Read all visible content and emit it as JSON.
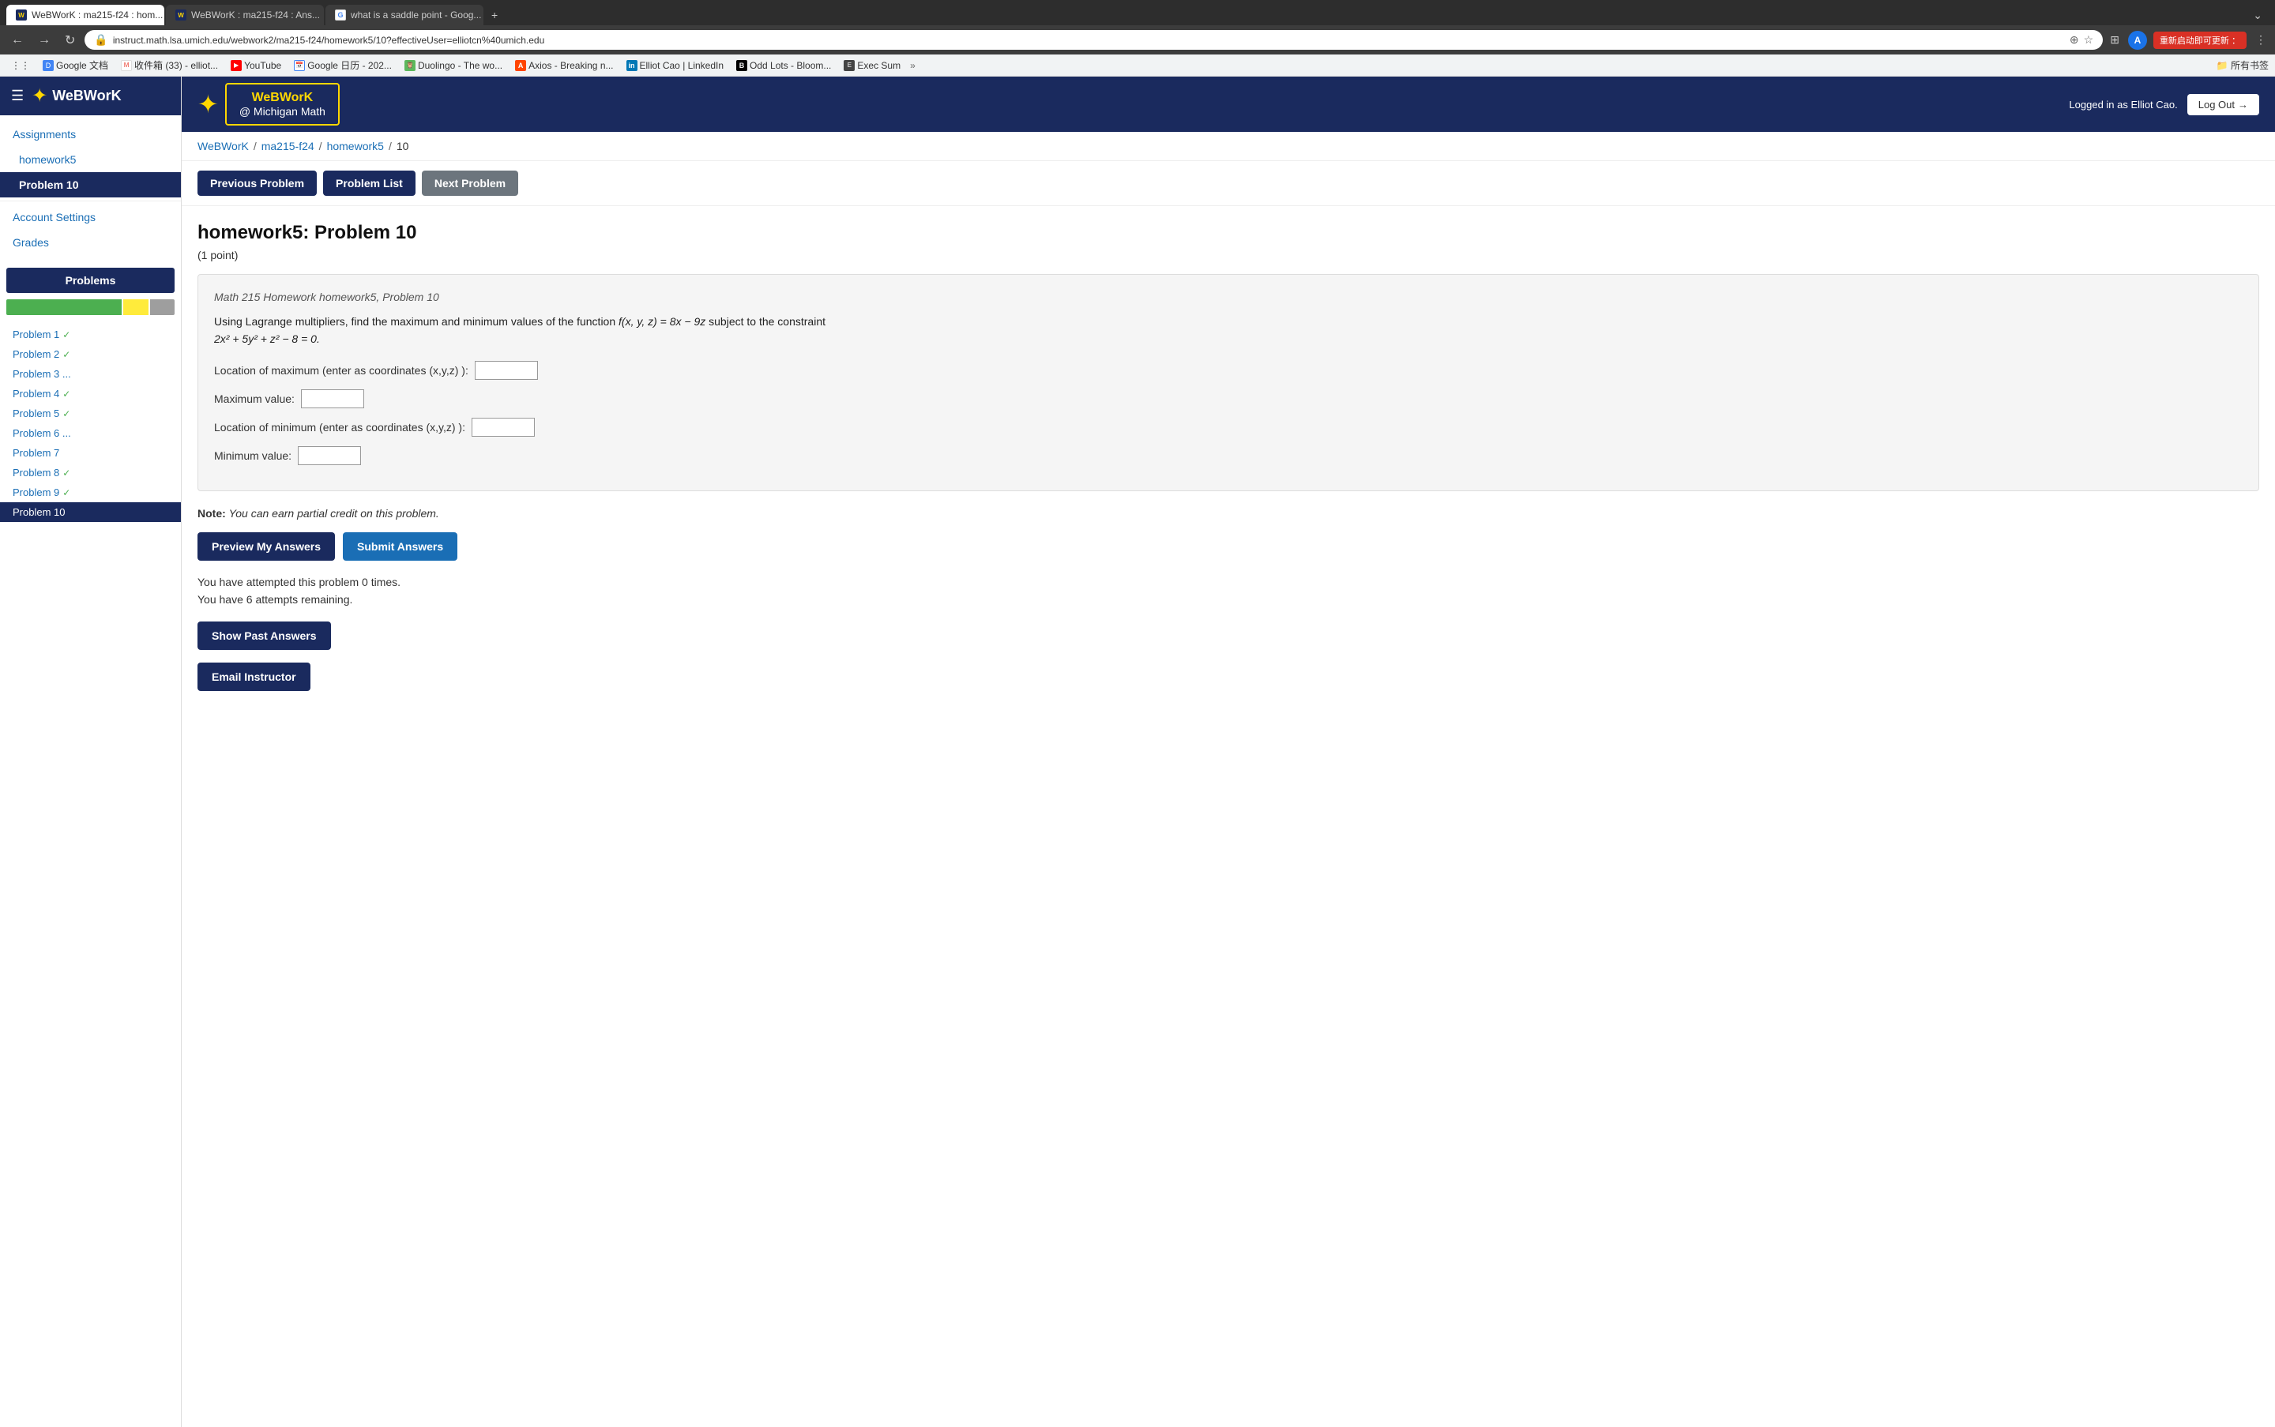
{
  "browser": {
    "tabs": [
      {
        "id": "tab1",
        "label": "WeBWorK : ma215-f24 : hom...",
        "active": true,
        "favicon_type": "webwork"
      },
      {
        "id": "tab2",
        "label": "WeBWorK : ma215-f24 : Ans...",
        "active": false,
        "favicon_type": "webwork"
      },
      {
        "id": "tab3",
        "label": "what is a saddle point - Goog...",
        "active": false,
        "favicon_type": "google"
      }
    ],
    "address": "instruct.math.lsa.umich.edu/webwork2/ma215-f24/homework5/10?effectiveUser=elliotcn%40umich.edu",
    "profile_initial": "A",
    "cjk_label": "重新启动即可更新 ："
  },
  "bookmarks": [
    {
      "label": "Google 文档",
      "favicon_type": "gdoc"
    },
    {
      "label": "收件箱 (33) - elliot...",
      "favicon_type": "gmail"
    },
    {
      "label": "YouTube",
      "favicon_type": "yt"
    },
    {
      "label": "Google 日历 - 202...",
      "favicon_type": "cal"
    },
    {
      "label": "Duolingo - The wo...",
      "favicon_type": "duo"
    },
    {
      "label": "Axios - Breaking n...",
      "favicon_type": "axios"
    },
    {
      "label": "Elliot Cao | LinkedIn",
      "favicon_type": "li"
    },
    {
      "label": "Odd Lots - Bloom...",
      "favicon_type": "bb"
    },
    {
      "label": "Exec Sum",
      "favicon_type": "exec"
    }
  ],
  "sidebar": {
    "logo_line1": "WeBWorK",
    "logo_line2": "@ Michigan Math",
    "nav_items": [
      {
        "label": "Assignments",
        "id": "assignments",
        "active": false,
        "indent": false
      },
      {
        "label": "homework5",
        "id": "homework5",
        "active": false,
        "indent": true
      },
      {
        "label": "Problem 10",
        "id": "problem10",
        "active": true,
        "indent": true
      }
    ],
    "bottom_nav": [
      {
        "label": "Account Settings",
        "id": "account-settings"
      },
      {
        "label": "Grades",
        "id": "grades"
      }
    ],
    "problems_header": "Problems",
    "progress": {
      "green": 7,
      "yellow": 1.5,
      "gray": 1.5
    },
    "problem_list": [
      {
        "label": "Problem 1",
        "check": "✓",
        "active": false
      },
      {
        "label": "Problem 2",
        "check": "✓",
        "active": false
      },
      {
        "label": "Problem 3 ...",
        "check": "",
        "active": false
      },
      {
        "label": "Problem 4",
        "check": "✓",
        "active": false
      },
      {
        "label": "Problem 5",
        "check": "✓",
        "active": false
      },
      {
        "label": "Problem 6 ...",
        "check": "",
        "active": false
      },
      {
        "label": "Problem 7",
        "check": "",
        "active": false
      },
      {
        "label": "Problem 8",
        "check": "✓",
        "active": false
      },
      {
        "label": "Problem 9",
        "check": "✓",
        "active": false
      },
      {
        "label": "Problem 10",
        "check": "",
        "active": true
      }
    ]
  },
  "header": {
    "logo_line1": "WeBWorK",
    "logo_line2": "@ Michigan Math",
    "logged_in_text": "Logged in as Elliot Cao.",
    "logout_label": "Log Out"
  },
  "breadcrumb": {
    "items": [
      "WeBWorK",
      "ma215-f24",
      "homework5",
      "10"
    ]
  },
  "problem_nav": {
    "previous_label": "Previous Problem",
    "list_label": "Problem List",
    "next_label": "Next Problem"
  },
  "problem": {
    "title": "homework5: Problem 10",
    "points": "(1 point)",
    "source": "Math 215 Homework homework5, Problem 10",
    "description_parts": [
      "Using Lagrange multipliers, find the maximum and minimum values of the function ",
      "f(x, y, z) = 8x − 9z",
      " subject to the constraint ",
      "2x² + 5y² + z² − 8 = 0."
    ],
    "inputs": [
      {
        "label": "Location of maximum (enter as coordinates (x,y,z) ):",
        "id": "max-location",
        "value": ""
      },
      {
        "label": "Maximum value:",
        "id": "max-value",
        "value": ""
      },
      {
        "label": "Location of minimum (enter as coordinates (x,y,z) ):",
        "id": "min-location",
        "value": ""
      },
      {
        "label": "Minimum value:",
        "id": "min-value",
        "value": ""
      }
    ],
    "note_label": "Note:",
    "note_text": "You can earn partial credit on this problem.",
    "buttons": [
      {
        "label": "Preview My Answers",
        "id": "preview-btn",
        "style": "dark-blue"
      },
      {
        "label": "Submit Answers",
        "id": "submit-btn",
        "style": "teal"
      }
    ],
    "attempts_text": "You have attempted this problem 0 times.",
    "remaining_text": "You have 6 attempts remaining.",
    "show_past_label": "Show Past Answers",
    "email_instructor_label": "Email Instructor"
  }
}
